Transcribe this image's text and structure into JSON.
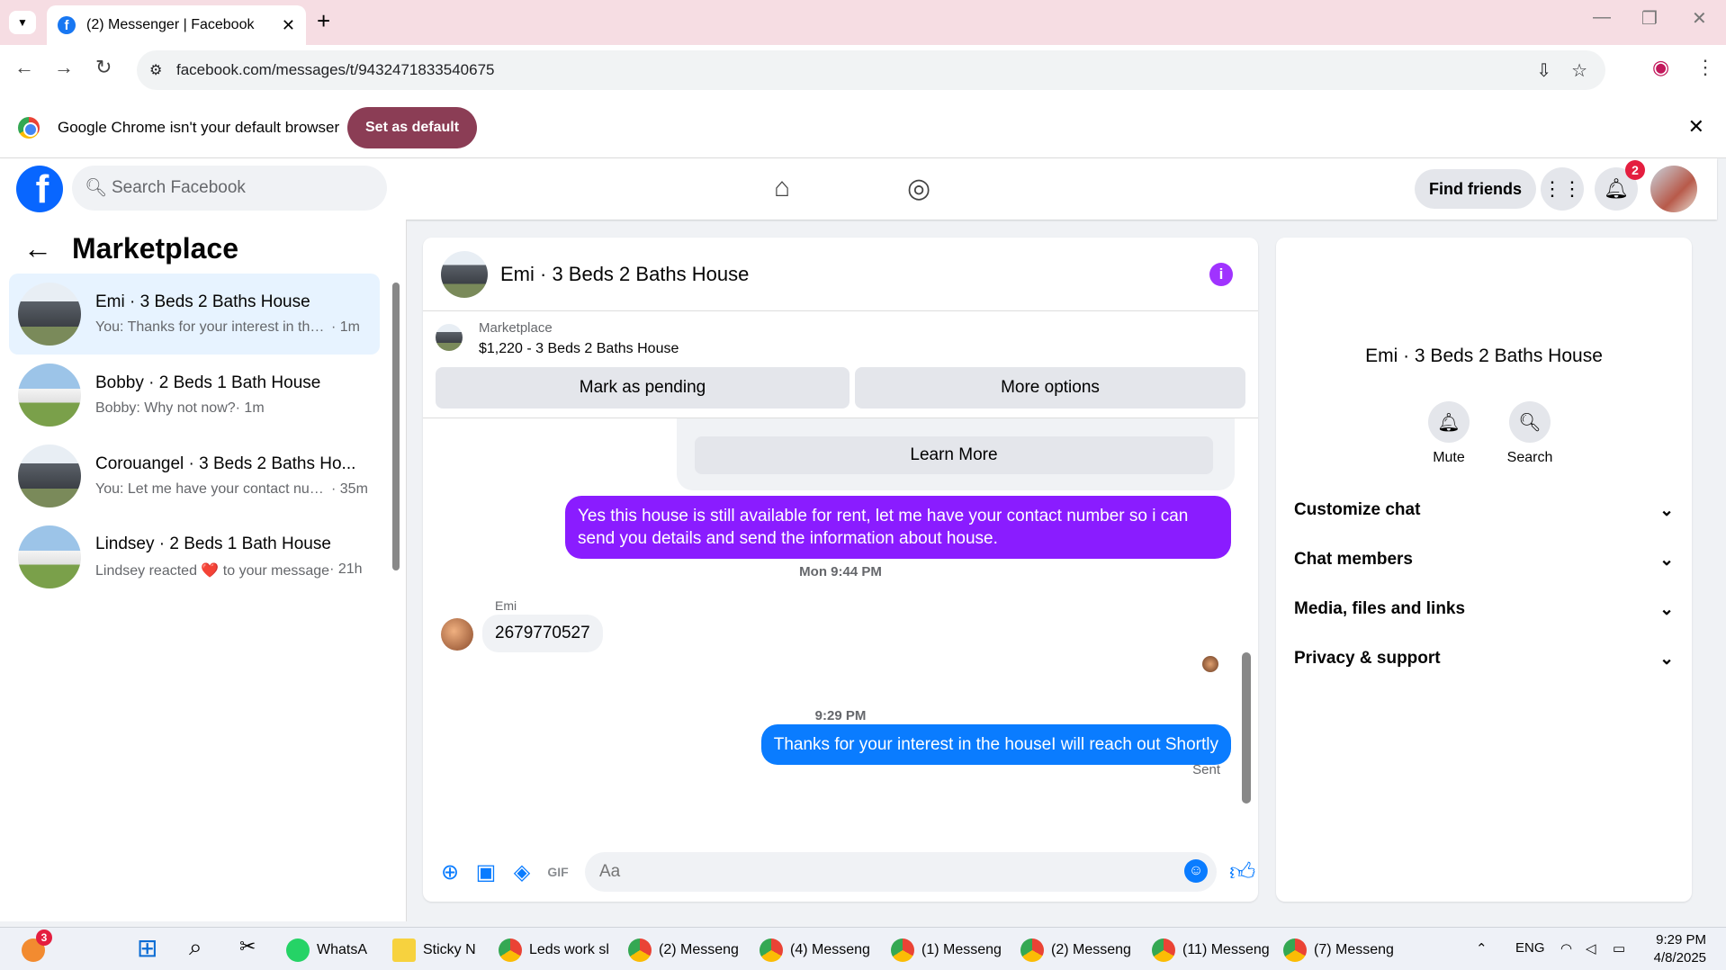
{
  "browser": {
    "tab_title": "(2) Messenger | Facebook",
    "url": "facebook.com/messages/t/9432471833540675",
    "info_text": "Google Chrome isn't your default browser",
    "set_default": "Set as default"
  },
  "fb": {
    "search_placeholder": "Search Facebook",
    "find_friends": "Find friends",
    "notif_count": "2"
  },
  "sidebar": {
    "title": "Marketplace",
    "conversations": [
      {
        "name": "Emi · 3 Beds 2 Baths House",
        "preview": "You: Thanks for your interest in the house I will reach out Shortly",
        "time": "· 1m"
      },
      {
        "name": "Bobby · 2 Beds 1 Bath House",
        "preview": "Bobby: Why not now?",
        "time": "· 1m"
      },
      {
        "name": "Corouangel · 3 Beds 2 Baths Ho...",
        "preview": "You: Let me have your contact number",
        "time": "· 35m"
      },
      {
        "name": "Lindsey · 2 Beds 1 Bath House",
        "preview": "Lindsey reacted ❤️ to your message",
        "time": "· 21h"
      }
    ]
  },
  "chat": {
    "title": "Emi · 3 Beds 2 Baths House",
    "listing_source": "Marketplace",
    "listing": "$1,220 - 3 Beds 2 Baths House",
    "mark_pending": "Mark as pending",
    "more_options": "More options",
    "learn_more": "Learn More",
    "messages": {
      "out1": "Yes this house is still available for rent, let me have your contact number so i can send you details and send the information about house.",
      "time1": "Mon 9:44 PM",
      "sender": "Emi",
      "in1": "2679770527",
      "time2": "9:29 PM",
      "out2": "Thanks for your interest in the houseI will reach out Shortly",
      "status": "Sent"
    },
    "input_placeholder": "Aa"
  },
  "details": {
    "name": "Emi · 3 Beds 2 Baths House",
    "mute": "Mute",
    "search": "Search",
    "sections": [
      "Customize chat",
      "Chat members",
      "Media, files and links",
      "Privacy & support"
    ]
  },
  "taskbar": {
    "badge": "3",
    "apps": [
      "WhatsA",
      "Sticky N",
      "Leds work sl",
      "(2) Messeng",
      "(4) Messeng",
      "(1) Messeng",
      "(2) Messeng",
      "(11) Messeng",
      "(7) Messeng"
    ],
    "lang": "ENG",
    "time": "9:29 PM",
    "date": "4/8/2025"
  }
}
